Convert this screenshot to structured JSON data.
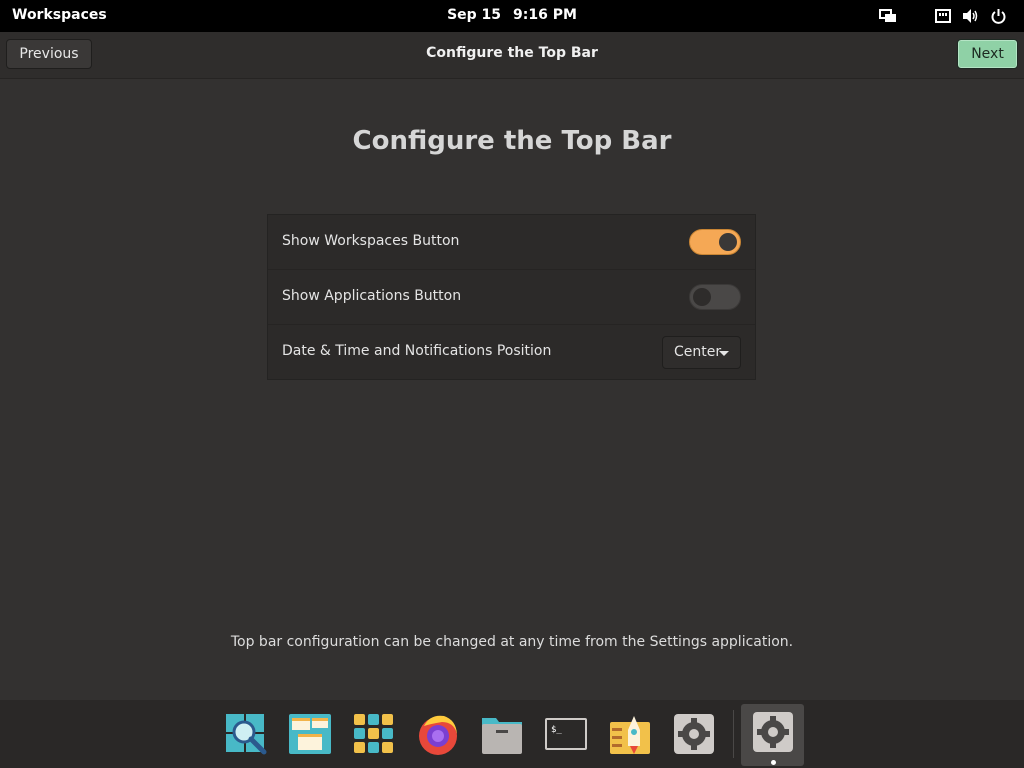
{
  "topbar": {
    "workspaces_label": "Workspaces",
    "date": "Sep 15",
    "time": "9:16 PM",
    "tray_icons": [
      "display-icon",
      "network-icon",
      "volume-icon",
      "power-icon"
    ]
  },
  "header": {
    "previous_label": "Previous",
    "title": "Configure the Top Bar",
    "next_label": "Next"
  },
  "main": {
    "title": "Configure the Top Bar",
    "rows": [
      {
        "label": "Show Workspaces Button",
        "control": "switch",
        "on": true
      },
      {
        "label": "Show Applications Button",
        "control": "switch",
        "on": false
      },
      {
        "label": "Date & Time and Notifications Position",
        "control": "dropdown",
        "value": "Center"
      }
    ],
    "footnote": "Top bar configuration can be changed at any time from the Settings application."
  },
  "dock": {
    "items": [
      "search-app-icon",
      "window-manager-icon",
      "applications-grid-icon",
      "firefox-icon",
      "files-icon",
      "terminal-icon",
      "launcher-icon",
      "settings-icon"
    ],
    "active_item": "initial-setup-icon"
  },
  "colors": {
    "accent": "#f5a855",
    "suggested": "#8fd1a6",
    "background": "#333130"
  }
}
